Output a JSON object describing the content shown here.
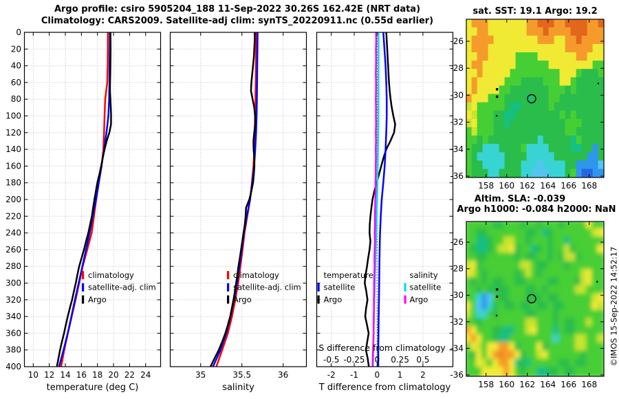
{
  "header": {
    "line1": "Argo profile: csiro 5905204_188 11-Sep-2022 30.26S 162.42E (NRT data)",
    "line2": "Climatology: CARS2009. Satellite-adj clim: synTS_20220911.nc (0.55d earlier)"
  },
  "credit": "©IMOS 15-Sep-2022 14:52:17",
  "palette": {
    "R": "#e2661c",
    "O": "#f59b2b",
    "y": "#f0ea35",
    "Y": "#c8e42f",
    "g": "#46cf35",
    "G": "#2abd4b",
    "t": "#16bf82",
    "c": "#38d4d4",
    "C": "#55c4f2",
    "b": "#2f96ee",
    "B": "#2468e0",
    "r": "#ef8822"
  },
  "chart_data": [
    {
      "id": "temperature-profile",
      "type": "line",
      "xlabel": "temperature (deg C)",
      "xticks": [
        10,
        12,
        14,
        16,
        18,
        20,
        22,
        24
      ],
      "yticks": [
        0,
        20,
        40,
        60,
        80,
        100,
        120,
        140,
        160,
        180,
        200,
        220,
        240,
        260,
        280,
        300,
        320,
        340,
        360,
        380,
        400
      ],
      "xlim": [
        8.9,
        25.87
      ],
      "ylim": [
        400,
        0
      ],
      "grid": true,
      "legend": [
        {
          "label": "climatology",
          "color": "#ff0000"
        },
        {
          "label": "satellite-adj. clim",
          "color": "#0000ff"
        },
        {
          "label": "Argo",
          "color": "#000000"
        }
      ],
      "series": [
        {
          "name": "climatology",
          "color": "#ff0000",
          "depth_step": 20,
          "values": [
            19.3,
            19.29,
            19.27,
            19.22,
            18.97,
            18.88,
            18.82,
            18.74,
            18.52,
            18.16,
            17.84,
            17.56,
            17.28,
            16.72,
            16.16,
            15.72,
            15.28,
            14.8,
            14.32,
            13.86,
            13.48
          ]
        },
        {
          "name": "satellite-adj. clim",
          "color": "#0000ff",
          "depth_step": 20,
          "values": [
            19.55,
            19.53,
            19.51,
            19.49,
            19.46,
            19.36,
            19.12,
            18.82,
            18.5,
            18.16,
            17.82,
            17.42,
            17.02,
            16.58,
            16.12,
            15.66,
            15.2,
            14.75,
            14.3,
            13.78,
            13.22
          ]
        },
        {
          "name": "Argo",
          "color": "#000000",
          "depth_step": 10,
          "values": [
            19.62,
            19.63,
            19.64,
            19.63,
            19.61,
            19.59,
            19.57,
            19.56,
            19.61,
            19.66,
            19.7,
            19.69,
            19.48,
            19.15,
            18.88,
            18.66,
            18.46,
            18.24,
            17.98,
            17.8,
            17.62,
            17.46,
            17.31,
            17.08,
            16.86,
            16.58,
            16.32,
            16.02,
            15.72,
            15.5,
            15.3,
            15.06,
            14.84,
            14.56,
            14.3,
            14.06,
            13.84,
            13.58,
            13.34,
            13.14,
            12.95
          ]
        }
      ]
    },
    {
      "id": "salinity-profile",
      "type": "line",
      "xlabel": "salinity",
      "xticks": [
        35,
        35.5,
        36
      ],
      "yticks": [
        0,
        20,
        40,
        60,
        80,
        100,
        120,
        140,
        160,
        180,
        200,
        220,
        240,
        260,
        280,
        300,
        320,
        340,
        360,
        380,
        400
      ],
      "xlim": [
        34.63,
        36.28
      ],
      "ylim": [
        400,
        0
      ],
      "grid": true,
      "legend": [
        {
          "label": "climatology",
          "color": "#ff0000"
        },
        {
          "label": "satellite-adj. clim",
          "color": "#0000ff"
        },
        {
          "label": "Argo",
          "color": "#000000"
        }
      ],
      "series": [
        {
          "name": "climatology",
          "color": "#ff0000",
          "depth_step": 20,
          "values": [
            35.672,
            35.672,
            35.67,
            35.668,
            35.664,
            35.66,
            35.655,
            35.65,
            35.64,
            35.622,
            35.6,
            35.565,
            35.532,
            35.508,
            35.482,
            35.455,
            35.42,
            35.38,
            35.33,
            35.262,
            35.19
          ]
        },
        {
          "name": "satellite-adj. clim",
          "color": "#0000ff",
          "depth_step": 20,
          "values": [
            35.69,
            35.688,
            35.686,
            35.684,
            35.682,
            35.678,
            35.672,
            35.662,
            35.648,
            35.625,
            35.598,
            35.56,
            35.525,
            35.498,
            35.47,
            35.442,
            35.405,
            35.362,
            35.31,
            35.24,
            35.15
          ]
        },
        {
          "name": "Argo",
          "color": "#000000",
          "depth_step": 10,
          "values": [
            35.655,
            35.655,
            35.65,
            35.645,
            35.635,
            35.625,
            35.615,
            35.61,
            35.63,
            35.65,
            35.66,
            35.662,
            35.65,
            35.64,
            35.642,
            35.65,
            35.652,
            35.645,
            35.635,
            35.615,
            35.59,
            35.55,
            35.545,
            35.535,
            35.52,
            35.505,
            35.49,
            35.475,
            35.458,
            35.445,
            35.43,
            35.415,
            35.398,
            35.378,
            35.358,
            35.33,
            35.3,
            35.262,
            35.22,
            35.168,
            35.12
          ]
        }
      ]
    },
    {
      "id": "difference-profile",
      "type": "line",
      "xlabel": "T difference from climatology",
      "xticks": [
        -2,
        -1,
        0,
        1,
        2
      ],
      "yticks": [
        0,
        20,
        40,
        60,
        80,
        100,
        120,
        140,
        160,
        180,
        200,
        220,
        240,
        260,
        280,
        300,
        320,
        340,
        360,
        380,
        400
      ],
      "xlim": [
        -2.64,
        3.31
      ],
      "ylim": [
        400,
        0
      ],
      "grid": true,
      "zero_line": true,
      "inner_axis": {
        "label": "S difference from climatology",
        "ticks": [
          "-0.5",
          "-0.25",
          "0",
          "0.25",
          "0.5"
        ],
        "values": [
          -0.5,
          -0.25,
          0,
          0.25,
          0.5
        ],
        "scale": 4
      },
      "legend_groups": [
        {
          "title": "temperature",
          "entries": [
            {
              "label": "satellite",
              "color": "#0000ff"
            },
            {
              "label": "Argo",
              "color": "#000000"
            }
          ]
        },
        {
          "title": "salinity",
          "entries": [
            {
              "label": "satellite",
              "color": "#00dcee"
            },
            {
              "label": "Argo",
              "color": "#ff00ff"
            }
          ]
        }
      ],
      "series": [
        {
          "name": "Argo T diff",
          "color": "#000000",
          "axis": "T",
          "depth_step": 10,
          "values": [
            0.4,
            0.42,
            0.44,
            0.46,
            0.48,
            0.5,
            0.52,
            0.55,
            0.59,
            0.64,
            0.71,
            0.79,
            0.74,
            0.58,
            0.4,
            0.28,
            0.18,
            0.08,
            -0.02,
            -0.12,
            -0.2,
            -0.25,
            -0.29,
            -0.32,
            -0.33,
            -0.29,
            -0.33,
            -0.39,
            -0.44,
            -0.5,
            -0.54,
            -0.47,
            -0.42,
            -0.48,
            -0.52,
            -0.44,
            -0.37,
            -0.43,
            -0.49,
            -0.41,
            -0.36
          ]
        },
        {
          "name": "satellite T diff",
          "color": "#0000ff",
          "axis": "T",
          "depth_step": 20,
          "values": [
            0.27,
            0.32,
            0.37,
            0.4,
            0.42,
            0.42,
            0.4,
            0.37,
            0.33,
            0.27,
            0.2,
            0.16,
            0.13,
            0.11,
            0.1,
            0.09,
            0.08,
            0.07,
            0.06,
            0.05,
            0.05
          ]
        },
        {
          "name": "satellite S diff",
          "color": "#00dcee",
          "axis": "S",
          "depth_step": 20,
          "values": [
            0.015,
            0.016,
            0.016,
            0.015,
            0.015,
            0.014,
            0.012,
            0.01,
            0.007,
            0.004,
            0.0,
            -0.005,
            -0.01,
            -0.015,
            -0.02,
            -0.025,
            -0.03,
            -0.034,
            -0.038,
            -0.042,
            -0.045
          ]
        },
        {
          "name": "Argo S diff",
          "color": "#ff00ff",
          "axis": "S",
          "depth_step": 10,
          "values": [
            -0.012,
            -0.01,
            -0.013,
            -0.011,
            -0.012,
            -0.014,
            -0.011,
            -0.012,
            -0.014,
            -0.012,
            -0.013,
            -0.011,
            -0.014,
            -0.012,
            -0.015,
            -0.013,
            -0.016,
            -0.014,
            -0.018,
            -0.016,
            -0.02,
            -0.022,
            -0.024,
            -0.023,
            -0.026,
            -0.024,
            -0.027,
            -0.029,
            -0.028,
            -0.031,
            -0.033,
            -0.032,
            -0.035,
            -0.034,
            -0.037,
            -0.039,
            -0.038,
            -0.041,
            -0.044,
            -0.047,
            -0.05
          ]
        }
      ]
    },
    {
      "id": "sst-map",
      "type": "heatmap",
      "title": "sat. SST: 19.1 Argo: 19.2",
      "xticks": [
        158,
        160,
        162,
        164,
        166,
        168
      ],
      "yticks": [
        -26,
        -28,
        -30,
        -32,
        -34,
        -36
      ],
      "lon_range": [
        156.1,
        169.4
      ],
      "lat_range": [
        -24.4,
        -36.1
      ],
      "marker": {
        "lon": 162.42,
        "lat": -30.26
      },
      "dots": [
        [
          159.05,
          -29.55
        ],
        [
          159.05,
          -30.1
        ],
        [
          159.05,
          -31.55
        ],
        [
          168.9,
          -29.15
        ]
      ],
      "smooth": false,
      "rows": [
        "yOOOyyyyyyyOORRROORRRROOR",
        "yyOOyyyyyyyOOOROOOORRROOO",
        "yOOOOyyyyyyyyOOOyyOOROOOO",
        "yOOOyyyyyyyyyyyyyyOOOOOyy",
        "yyOOyyyyyggggyyyyyyyOOyyy",
        "yOOyyyyyyggggggyyyyyyyygg",
        "yyOyyyyygggggggggyyygGGGg",
        "yOyyyyygggGGGGgggyygGGGGG",
        "yOyyyyggGGGGGGGgggGgGGGGG",
        "OyyygggGGGGtGGGggGGGGGGGG",
        "YygggggGttGGGGGgGGGGGGGGG",
        "yYgggGGttGGGGGGGGgGgGGGGG",
        "YygggGGtGGGGGGGGGGgggGGGG",
        "gYgggGGGGGGGGGGGGGggGGGGG",
        "ggGgGGGGGGGGGcGGGGGtgGGGG",
        "gGGcccGGGGgccccGGGGttGGbG",
        "gGcccccGGGGcccccGGGGGGbbG",
        "gGGccccGGGcccCccccGGbbbbC",
        "gGGGccGGGGccCCCcccGgbBBbb"
      ]
    },
    {
      "id": "sla-map",
      "type": "heatmap",
      "title_line1": "Altim. SLA: -0.039",
      "title_line2": "Argo h1000: -0.084 h2000: NaN",
      "xticks": [
        158,
        160,
        162,
        164,
        166,
        168
      ],
      "yticks": [
        -26,
        -28,
        -30,
        -32,
        -34,
        -36
      ],
      "lon_range": [
        156.1,
        169.4
      ],
      "lat_range": [
        -24.45,
        -36.1
      ],
      "marker": {
        "lon": 162.42,
        "lat": -30.26
      },
      "dots": [
        [
          159.05,
          -29.55
        ],
        [
          159.05,
          -30.1
        ],
        [
          159.05,
          -31.55
        ],
        [
          168.8,
          -29.0
        ]
      ],
      "smooth": true,
      "rows": [
        "gggggGGgggGggGgggGggggygg",
        "ggGGgggggggGGgtGgggggggYy",
        "ggttGggYYggGgggGggtgggggg",
        "gGttGgYYyGggtGgGggYGggggy",
        "ggGGgggggGgGGggGgGYYGgggg",
        "YyGgggggggYYgGGgggGgggggg",
        "yYgGgggggGgYgGgggggggYygg",
        "gGgGgGGggGGggggGGgggGYygg",
        "ggGgGGGGgggGGgGgggggYYggg",
        "ggcbCgGGgggGGGgGGggggggYy",
        "ygCbcGgGGgGGgGGgGGgggggyY",
        "YgccgGgggggGGgggGgggggggg",
        "ggGggggggggYYgggGgGGggYgg",
        "OygggGGttggYygggtgGGggggg",
        "yOyggGttggggggggcgggYYggY",
        "gyYgyyOOyGgggyGgggggYYggg",
        "gGygyOrOOyGggYyggggggGggg",
        "ggyYgyOOytGtgggggGGgGGggg",
        "gggyyyyOygGggttGGgGGggggg"
      ]
    }
  ]
}
